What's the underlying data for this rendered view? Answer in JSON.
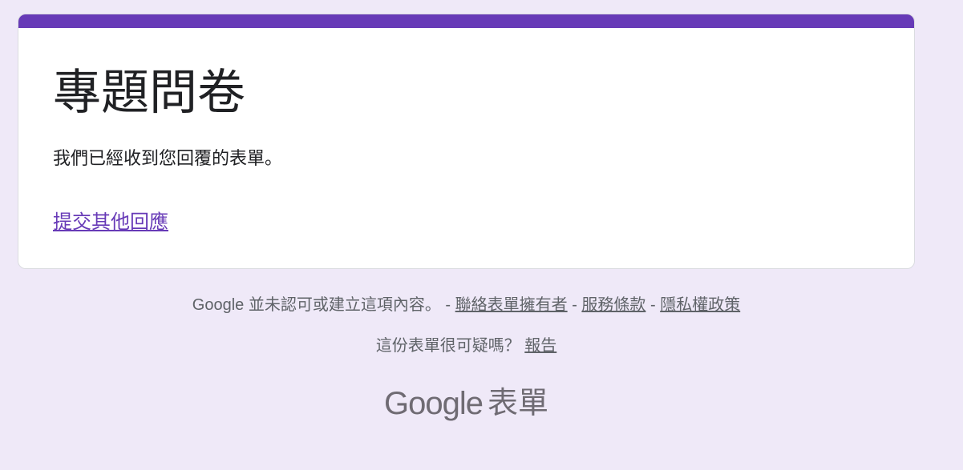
{
  "form": {
    "title": "專題問卷",
    "confirmation": "我們已經收到您回覆的表單。",
    "resubmit_link": "提交其他回應"
  },
  "footer": {
    "disclaimer": "Google 並未認可或建立這項內容。",
    "sep1": " - ",
    "contact_owner": "聯絡表單擁有者",
    "sep2": " - ",
    "terms": "服務條款",
    "sep3": " - ",
    "privacy": "隱私權政策",
    "suspicious_question": "這份表單很可疑嗎？",
    "report": "報告"
  },
  "brand": {
    "google": "Google",
    "product": "表單"
  },
  "colors": {
    "accent": "#673ab7",
    "background": "#efe9f8",
    "card": "#ffffff",
    "footer_text": "#5f6368"
  }
}
